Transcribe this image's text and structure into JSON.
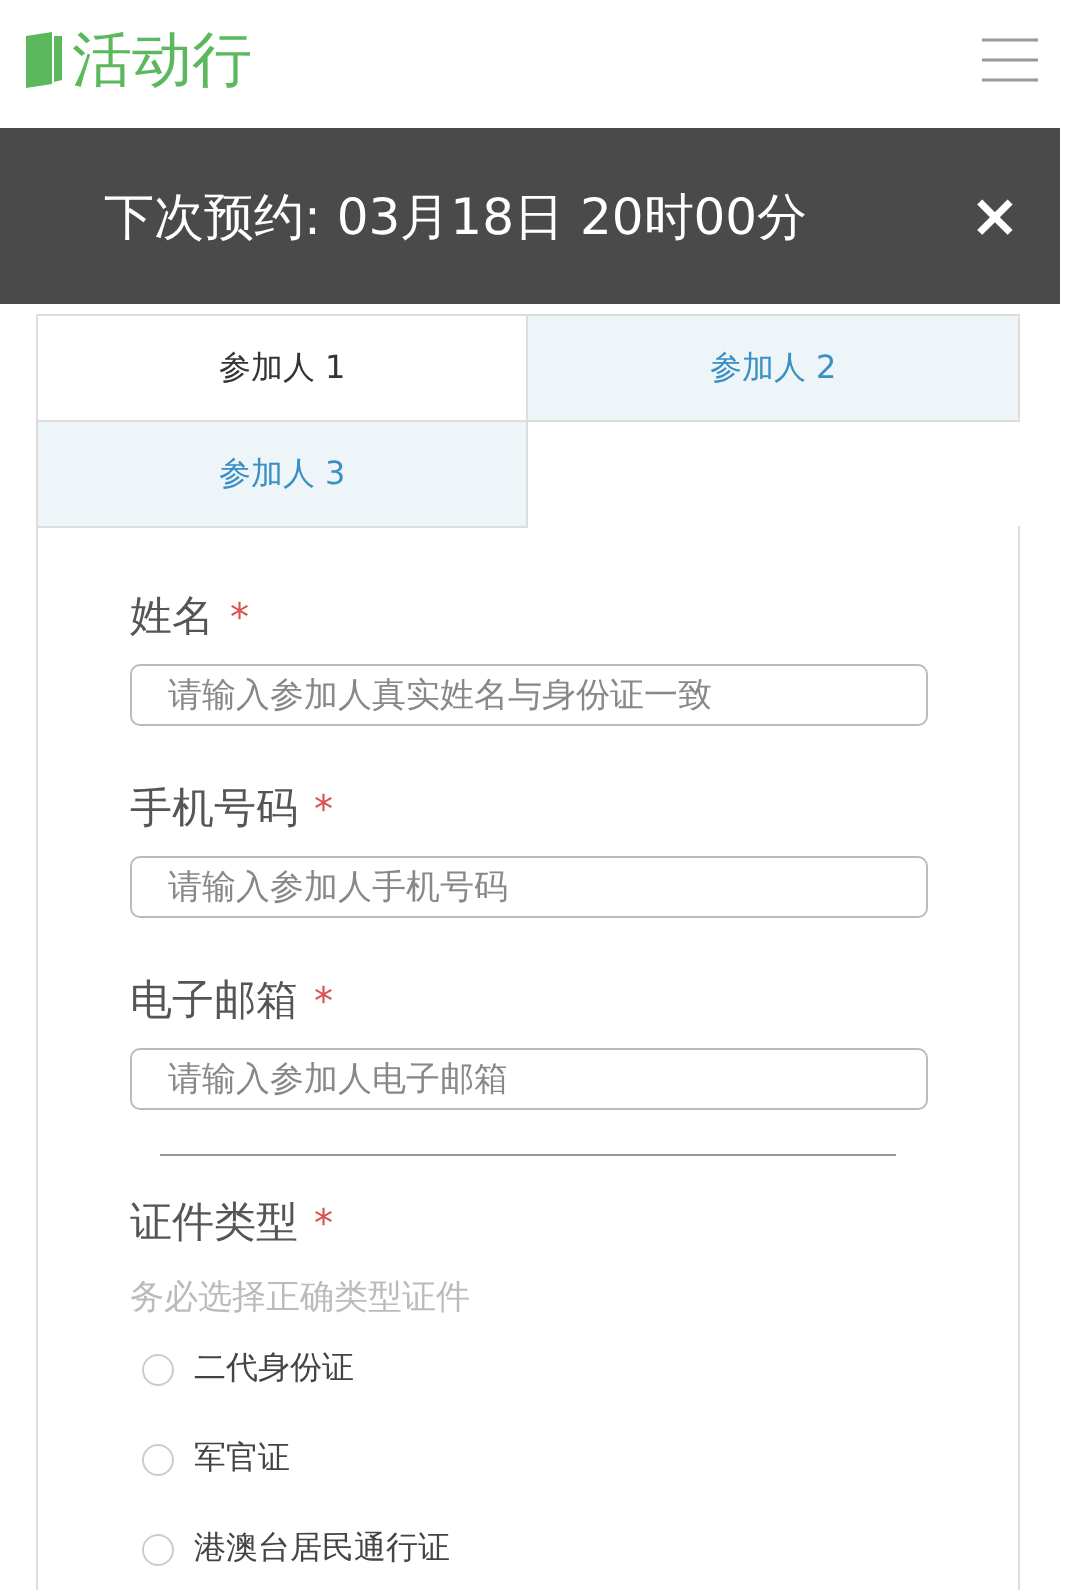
{
  "header": {
    "logo_text": "活动行"
  },
  "notice": {
    "text": "下次预约: 03月18日 20时00分",
    "close": "×"
  },
  "tabs": [
    {
      "label": "参加人 1",
      "selected": true
    },
    {
      "label": "参加人 2",
      "selected": false
    },
    {
      "label": "参加人 3",
      "selected": false
    }
  ],
  "fields": [
    {
      "label": "姓名",
      "required_mark": "*",
      "placeholder": "请输入参加人真实姓名与身份证一致"
    },
    {
      "label": "手机号码",
      "required_mark": "*",
      "placeholder": "请输入参加人手机号码"
    },
    {
      "label": "电子邮箱",
      "required_mark": "*",
      "placeholder": "请输入参加人电子邮箱"
    }
  ],
  "id_type": {
    "label": "证件类型",
    "required_mark": "*",
    "hint": "务必选择正确类型证件",
    "options": [
      {
        "label": "二代身份证",
        "selected": false
      },
      {
        "label": "军官证",
        "selected": false
      },
      {
        "label": "港澳台居民通行证",
        "selected": false
      }
    ]
  }
}
